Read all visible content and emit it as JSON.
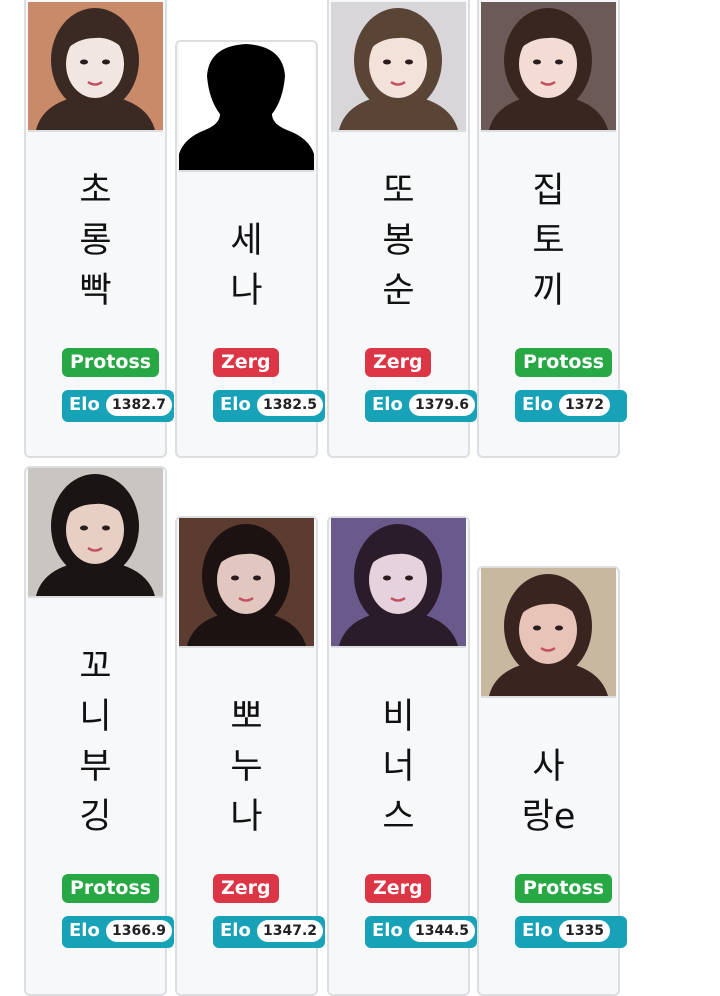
{
  "players": [
    {
      "name_lines": [
        "초",
        "롱",
        "빡"
      ],
      "race": "Protoss",
      "elo_label": "Elo",
      "elo": "1382.7",
      "photo": "woman-portrait",
      "race_color": "#28a745",
      "photo_colors": [
        "#c98a6a",
        "#f2e6e2",
        "#3b2a24"
      ]
    },
    {
      "name_lines": [
        "세",
        "나"
      ],
      "race": "Zerg",
      "elo_label": "Elo",
      "elo": "1382.5",
      "photo": "silhouette-placeholder",
      "race_color": "#dc3545",
      "photo_colors": [
        "#ffffff",
        "#000000",
        "#000000"
      ]
    },
    {
      "name_lines": [
        "또",
        "봉",
        "순"
      ],
      "race": "Zerg",
      "elo_label": "Elo",
      "elo": "1379.6",
      "photo": "woman-portrait",
      "race_color": "#dc3545",
      "photo_colors": [
        "#d8d6d8",
        "#f3e2da",
        "#5a4436"
      ]
    },
    {
      "name_lines": [
        "집",
        "토",
        "끼"
      ],
      "race": "Protoss",
      "elo_label": "Elo",
      "elo": "1372",
      "photo": "woman-portrait",
      "race_color": "#28a745",
      "photo_colors": [
        "#6b5a58",
        "#f2dcd4",
        "#3a2620"
      ]
    },
    {
      "name_lines": [
        "꼬",
        "니",
        "부",
        "깅"
      ],
      "race": "Protoss",
      "elo_label": "Elo",
      "elo": "1366.9",
      "photo": "woman-portrait",
      "race_color": "#28a745",
      "photo_colors": [
        "#c9c6c2",
        "#e8cfc4",
        "#1a1414"
      ]
    },
    {
      "name_lines": [
        "뽀",
        "누",
        "나"
      ],
      "race": "Zerg",
      "elo_label": "Elo",
      "elo": "1347.2",
      "photo": "woman-portrait",
      "race_color": "#dc3545",
      "photo_colors": [
        "#5c3c30",
        "#e2c7c0",
        "#1c1212"
      ]
    },
    {
      "name_lines": [
        "비",
        "너",
        "스"
      ],
      "race": "Zerg",
      "elo_label": "Elo",
      "elo": "1344.5",
      "photo": "woman-portrait",
      "race_color": "#dc3545",
      "photo_colors": [
        "#6a5a8c",
        "#e6d2dc",
        "#2a1c2a"
      ]
    },
    {
      "name_lines": [
        "사",
        "랑e"
      ],
      "race": "Protoss",
      "elo_label": "Elo",
      "elo": "1335",
      "photo": "woman-portrait",
      "race_color": "#28a745",
      "photo_colors": [
        "#c8b8a0",
        "#e8c4b8",
        "#3a2420"
      ]
    }
  ]
}
